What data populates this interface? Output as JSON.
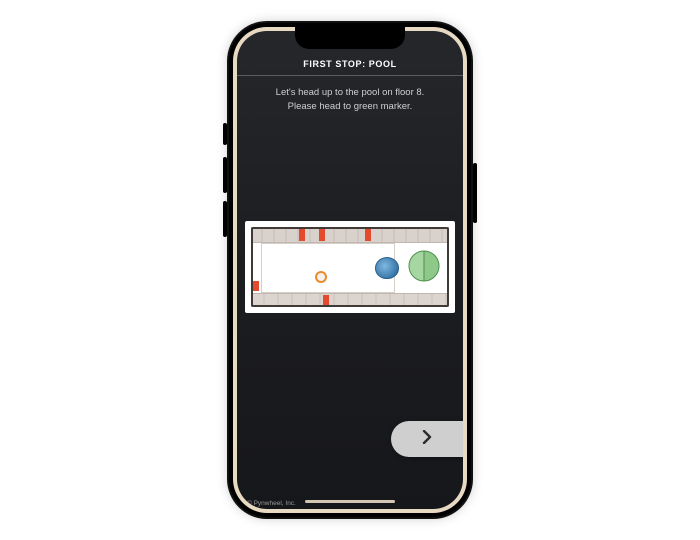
{
  "header": {
    "title": "FIRST STOP: POOL"
  },
  "instructions": {
    "line1": "Let's head up to the pool on floor 8.",
    "line2": "Please head to green marker."
  },
  "footer": {
    "credit": "© Pynwheel, Inc."
  },
  "icons": {
    "next": "chevron-right"
  },
  "colors": {
    "accent_red": "#e44a2d",
    "marker_green": "#7fbf7a",
    "pool_blue": "#2f6fa3"
  }
}
